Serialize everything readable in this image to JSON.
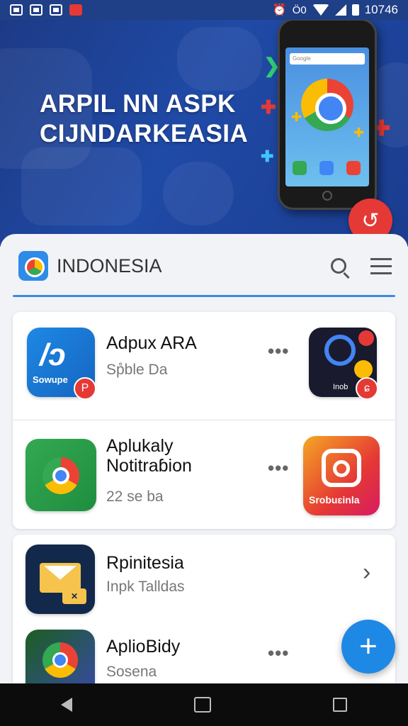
{
  "status_bar": {
    "network_label": "Ö0",
    "time": "10746"
  },
  "hero": {
    "line1": "ARPIL NN ASPK",
    "line2": "CIJNDARKEASIA",
    "phone_search_hint": "Google"
  },
  "header": {
    "brand": "INDONESIA"
  },
  "apps": [
    {
      "title": "Adpux ARA",
      "subtitle": "Sp̊ble Da",
      "icon_text": "/ɔ",
      "icon_caption": "Sowupe"
    },
    {
      "title": "Aplukaly\nNotitraɓion",
      "subtitle": "22 se ba",
      "right_caption": "Srobuɛinla"
    },
    {
      "title": "Rpinitesia",
      "subtitle": "Inpk Talldas"
    },
    {
      "title": "AplioBidy",
      "subtitle": "Sosena"
    }
  ],
  "right_icons": [
    {
      "caption": "Inob"
    }
  ],
  "more_label": "•••",
  "chevron_label": "›",
  "fab_label": "+",
  "colors": {
    "hero_bg": "#1f4aa6",
    "accent": "#1e88e5",
    "badge_red": "#e53935"
  }
}
